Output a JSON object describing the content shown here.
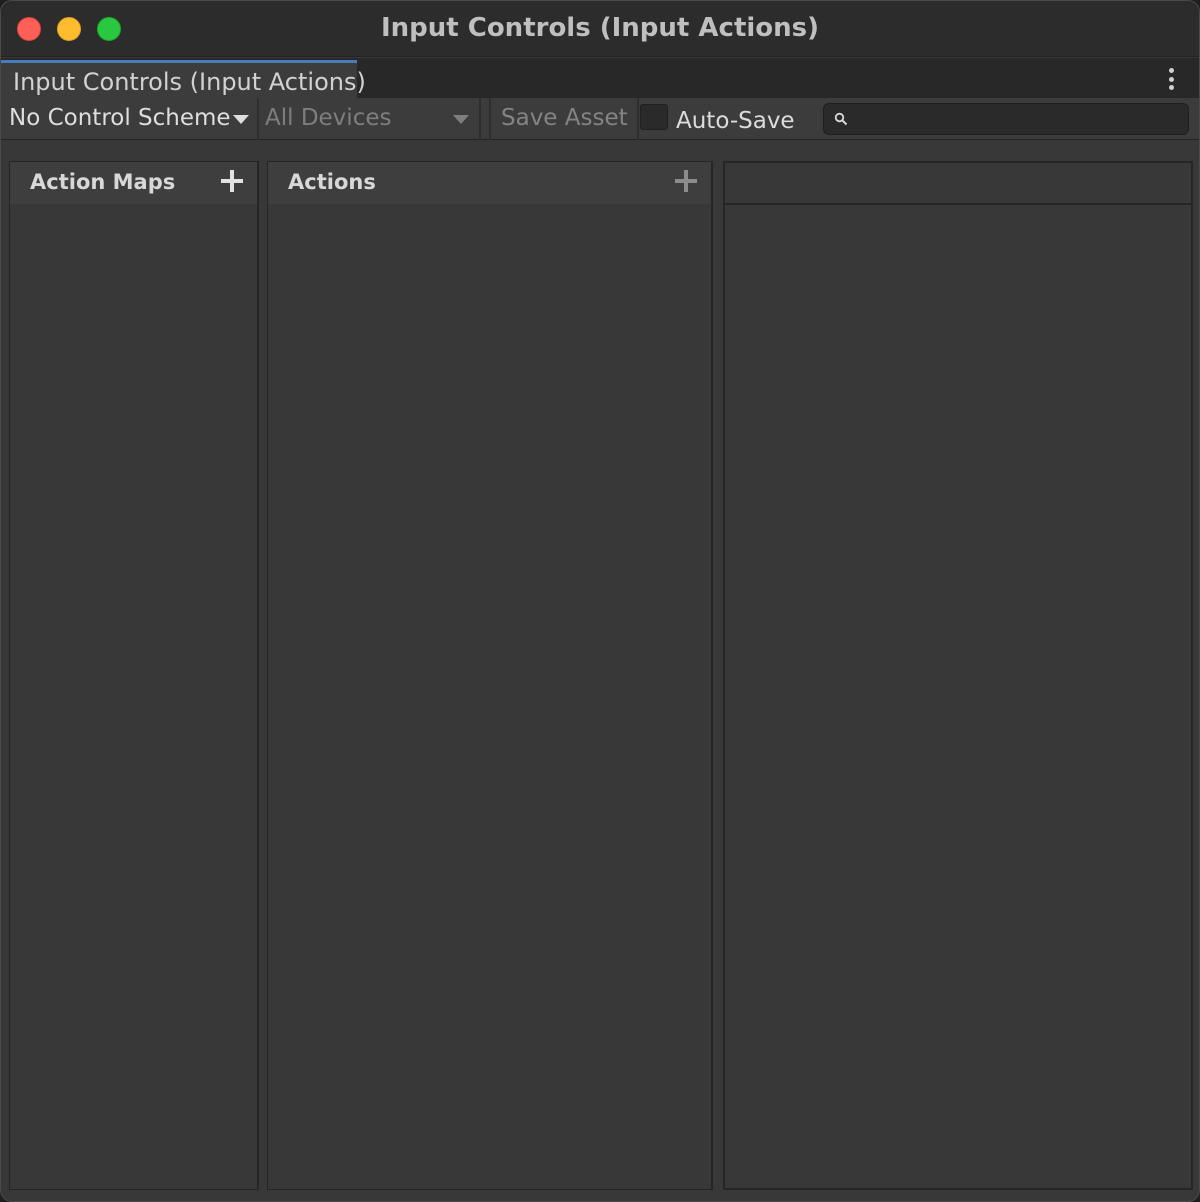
{
  "window": {
    "title": "Input Controls (Input Actions)"
  },
  "tab": {
    "label": "Input Controls (Input Actions)"
  },
  "toolbar": {
    "control_scheme": "No Control Scheme",
    "devices": "All Devices",
    "save_asset": "Save Asset",
    "auto_save": "Auto-Save",
    "auto_save_checked": false,
    "search_value": ""
  },
  "panels": {
    "action_maps": {
      "title": "Action Maps",
      "items": []
    },
    "actions": {
      "title": "Actions",
      "items": []
    },
    "properties": {
      "title": ""
    }
  },
  "colors": {
    "accent": "#4a7cb8",
    "close": "#fe5f57",
    "minimize": "#febc2e",
    "maximize": "#28c840"
  }
}
